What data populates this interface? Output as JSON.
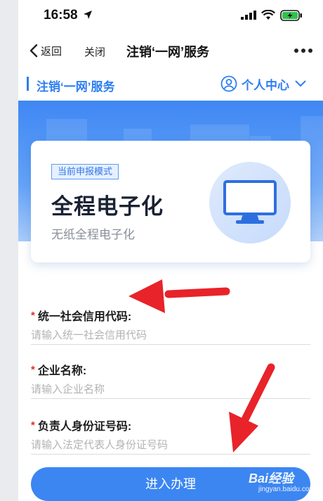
{
  "status_bar": {
    "time": "16:58"
  },
  "nav": {
    "back_label": "返回",
    "close_label": "关闭",
    "title": "注销‘一网’服务"
  },
  "header": {
    "title": "注销‘一网’服务",
    "personal_center": "个人中心"
  },
  "card": {
    "mode_tag": "当前申报模式",
    "title": "全程电子化",
    "subtitle": "无纸全程电子化"
  },
  "form": {
    "fields": [
      {
        "label": "统一社会信用代码:",
        "placeholder": "请输入统一社会信用代码",
        "value": ""
      },
      {
        "label": "企业名称:",
        "placeholder": "请输入企业名称",
        "value": ""
      },
      {
        "label": "负责人身份证号码:",
        "placeholder": "请输入法定代表人身份证号码",
        "value": ""
      }
    ],
    "required_mark": "*",
    "submit_label": "进入办理"
  },
  "watermark": {
    "logo": "Bai经验",
    "sub": "jingyan.baidu.com"
  },
  "colors": {
    "accent": "#2d7ef0",
    "button": "#3c86f2",
    "required": "#e0322e",
    "annotation": "#e8232a"
  },
  "icons": [
    "location-arrow-icon",
    "signal-icon",
    "wifi-icon",
    "battery-charging-icon",
    "back-chevron-icon",
    "more-dots-icon",
    "user-circle-icon",
    "chevron-down-icon",
    "monitor-icon"
  ]
}
